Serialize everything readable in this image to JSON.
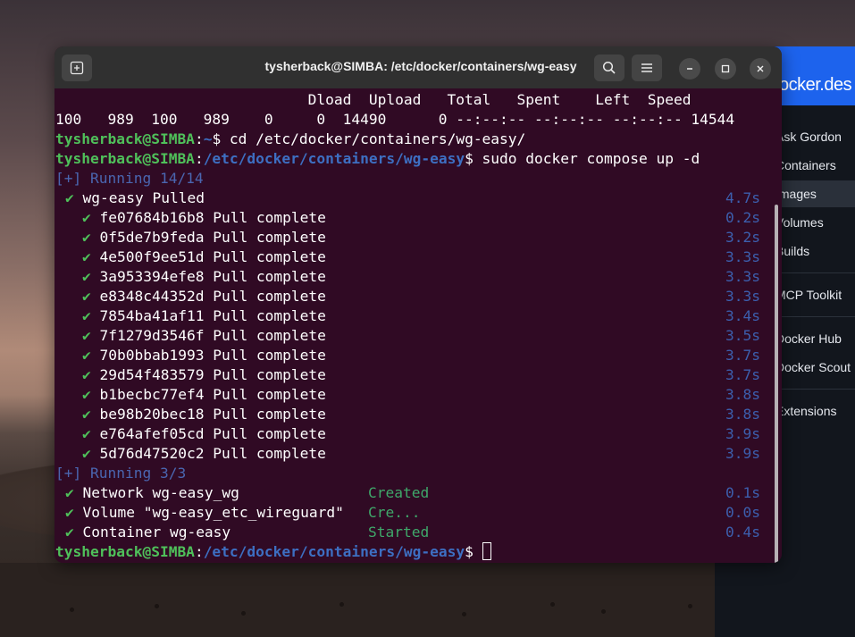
{
  "terminal": {
    "title": "tysherback@SIMBA: /etc/docker/containers/wg-easy",
    "curl_header": "                             Dload  Upload   Total   Spent    Left  Speed",
    "curl_row": "100   989  100   989    0     0  14490      0 --:--:-- --:--:-- --:--:-- 14544",
    "prompt_user": "tysherback@SIMBA",
    "prompt1_path": "~",
    "cmd1": " cd /etc/docker/containers/wg-easy/",
    "prompt2_path": "/etc/docker/containers/wg-easy",
    "cmd2": " sudo docker compose up -d",
    "running1": "[+] Running 14/14",
    "pulled_label": " wg-easy Pulled",
    "pulled_time": "4.7s",
    "layers": [
      {
        "id": "fe07684b16b8",
        "status": "Pull complete",
        "time": "0.2s"
      },
      {
        "id": "0f5de7b9feda",
        "status": "Pull complete",
        "time": "3.2s"
      },
      {
        "id": "4e500f9ee51d",
        "status": "Pull complete",
        "time": "3.3s"
      },
      {
        "id": "3a953394efe8",
        "status": "Pull complete",
        "time": "3.3s"
      },
      {
        "id": "e8348c44352d",
        "status": "Pull complete",
        "time": "3.3s"
      },
      {
        "id": "7854ba41af11",
        "status": "Pull complete",
        "time": "3.4s"
      },
      {
        "id": "7f1279d3546f",
        "status": "Pull complete",
        "time": "3.5s"
      },
      {
        "id": "70b0bbab1993",
        "status": "Pull complete",
        "time": "3.7s"
      },
      {
        "id": "29d54f483579",
        "status": "Pull complete",
        "time": "3.7s"
      },
      {
        "id": "b1becbc77ef4",
        "status": "Pull complete",
        "time": "3.8s"
      },
      {
        "id": "be98b20bec18",
        "status": "Pull complete",
        "time": "3.8s"
      },
      {
        "id": "e764afef05cd",
        "status": "Pull complete",
        "time": "3.9s"
      },
      {
        "id": "5d76d47520c2",
        "status": "Pull complete",
        "time": "3.9s"
      }
    ],
    "running2": "[+] Running 3/3",
    "resources": [
      {
        "name": " Network wg-easy_wg",
        "state": "Created",
        "time": "0.1s"
      },
      {
        "name": " Volume \"wg-easy_etc_wireguard\"",
        "state": "Cre...",
        "time": "0.0s"
      },
      {
        "name": " Container wg-easy",
        "state": "Started",
        "time": "0.4s"
      }
    ],
    "prompt3_path": "/etc/docker/containers/wg-easy"
  },
  "docker_desktop": {
    "brand": "ocker.des",
    "nav": [
      "Ask Gordon",
      "Containers",
      "Images",
      "Volumes",
      "Builds",
      "MCP Toolkit",
      "Docker Hub",
      "Docker Scout",
      "Extensions"
    ],
    "active": "Images"
  },
  "colors": {
    "terminal_bg": "#300a24",
    "prompt_green": "#4fc05a",
    "path_blue": "#3d6fc2",
    "docker_blue": "#1d63ed"
  }
}
